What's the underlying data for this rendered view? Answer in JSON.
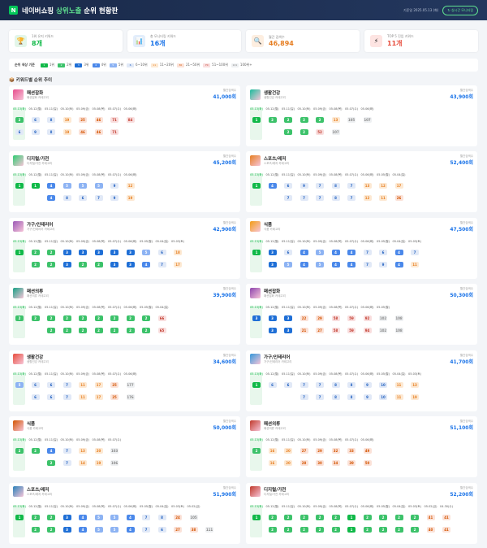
{
  "header": {
    "logo": "N",
    "title_a": "네이버쇼핑 ",
    "title_hl": "상위노출",
    "title_b": " 순위 현황판",
    "date": "기준일 2025.05.13 (화)",
    "btn": "↻ 실시간 모니터링"
  },
  "stats": [
    {
      "icon": "🏆",
      "label": "1위 유지 키워드",
      "value": "8개",
      "color": "#10b948",
      "bg": "#e3f6e9"
    },
    {
      "icon": "📊",
      "label": "총 모니터링 키워드",
      "value": "16개",
      "color": "#1a73e8",
      "bg": "#e3eefc"
    },
    {
      "icon": "🔍",
      "label": "월간 검색수",
      "value": "46,894",
      "color": "#e67e22",
      "bg": "#fdeee0"
    },
    {
      "icon": "⚡",
      "label": "TOP 5 진입 키워드",
      "value": "11개",
      "color": "#e74c3c",
      "bg": "#fde4e2"
    }
  ],
  "legend": {
    "title": "순위 색상 기준",
    "items": [
      {
        "label": "1위",
        "cls": "r1",
        "t": "1"
      },
      {
        "label": "2위",
        "cls": "r2",
        "t": "2"
      },
      {
        "label": "3위",
        "cls": "r3",
        "t": "3"
      },
      {
        "label": "4위",
        "cls": "r4",
        "t": "4"
      },
      {
        "label": "5위",
        "cls": "r5",
        "t": "5"
      },
      {
        "label": "6~10위",
        "cls": "r6",
        "t": "6"
      },
      {
        "label": "11~20위",
        "cls": "r10",
        "t": "11"
      },
      {
        "label": "21~50위",
        "cls": "r20",
        "t": "30"
      },
      {
        "label": "51~100위",
        "cls": "r50",
        "t": "70"
      },
      {
        "label": "100위+",
        "cls": "r100",
        "t": "101"
      }
    ]
  },
  "section_title": "📦 키워드별 순위 추이",
  "cards": [
    {
      "name": "패션잡화",
      "sub": "패션잡화 카테고리",
      "vlabel": "월간검색수",
      "volume": "41,000회",
      "color": "#e74c8c",
      "dates": [
        "05.13(화)",
        "05.12(월)",
        "05.11(일)",
        "05.10(토)",
        "05.09(금)",
        "05.08(목)",
        "05.07(수)",
        "05.06(화)"
      ],
      "row1": [
        "2",
        "6",
        "8",
        "19",
        "25",
        "46",
        "71",
        "84"
      ],
      "row2": [
        "6",
        "9",
        "8",
        "19",
        "46",
        "46",
        "71",
        ""
      ]
    },
    {
      "name": "생활건강",
      "sub": "생활건강 카테고리",
      "vlabel": "월간검색수",
      "volume": "43,900회",
      "color": "#1abc9c",
      "dates": [
        "05.13(화)",
        "05.12(월)",
        "05.11(일)",
        "05.10(토)",
        "05.09(금)",
        "05.08(목)",
        "05.07(수)",
        "05.06(화)"
      ],
      "row1": [
        "1",
        "2",
        "2",
        "2",
        "2",
        "13",
        "105",
        "107"
      ],
      "row2": [
        "",
        "",
        "2",
        "2",
        "52",
        "107",
        "",
        ""
      ]
    },
    {
      "name": "디지털/가전",
      "sub": "디지털/가전 카테고리",
      "vlabel": "월간검색수",
      "volume": "45,200회",
      "color": "#2ecc71",
      "dates": [
        "05.13(화)",
        "05.12(월)",
        "05.11(일)",
        "05.10(토)",
        "05.09(금)",
        "05.08(목)",
        "05.07(수)",
        "05.06(화)"
      ],
      "row1": [
        "1",
        "1",
        "4",
        "5",
        "5",
        "5",
        "9",
        "12"
      ],
      "row2": [
        "",
        "",
        "4",
        "8",
        "6",
        "7",
        "9",
        "19"
      ]
    },
    {
      "name": "스포츠/레저",
      "sub": "스포츠/레저 카테고리",
      "vlabel": "월간검색수",
      "volume": "52,400회",
      "color": "#e67e22",
      "dates": [
        "05.13(화)",
        "05.12(월)",
        "05.11(일)",
        "05.10(토)",
        "05.09(금)",
        "05.08(목)",
        "05.07(수)",
        "05.06(화)",
        "05.05(월)",
        "05.04(일)"
      ],
      "row1": [
        "1",
        "4",
        "6",
        "9",
        "7",
        "8",
        "7",
        "13",
        "12",
        "17"
      ],
      "row2": [
        "",
        "",
        "7",
        "7",
        "7",
        "8",
        "7",
        "12",
        "11",
        "26"
      ]
    },
    {
      "name": "가구/인테리어",
      "sub": "가구/인테리어 카테고리",
      "vlabel": "월간검색수",
      "volume": "42,900회",
      "color": "#9b59b6",
      "dates": [
        "05.13(화)",
        "05.12(월)",
        "05.11(일)",
        "05.10(토)",
        "05.09(금)",
        "05.08(목)",
        "05.07(수)",
        "05.06(화)",
        "05.05(월)",
        "05.04(일)",
        "05.03(토)"
      ],
      "row1": [
        "1",
        "2",
        "2",
        "3",
        "3",
        "3",
        "3",
        "3",
        "5",
        "6",
        "18"
      ],
      "row2": [
        "",
        "2",
        "2",
        "3",
        "2",
        "2",
        "3",
        "3",
        "4",
        "7",
        "17"
      ]
    },
    {
      "name": "식품",
      "sub": "식품 카테고리",
      "vlabel": "월간검색수",
      "volume": "47,500회",
      "color": "#f39c12",
      "dates": [
        "05.13(화)",
        "05.12(월)",
        "05.11(일)",
        "05.10(토)",
        "05.09(금)",
        "05.08(목)",
        "05.07(수)",
        "05.06(화)",
        "05.05(월)",
        "05.04(일)",
        "05.03(토)"
      ],
      "row1": [
        "1",
        "3",
        "6",
        "4",
        "5",
        "4",
        "4",
        "7",
        "6",
        "4",
        "7"
      ],
      "row2": [
        "",
        "3",
        "5",
        "4",
        "5",
        "4",
        "4",
        "7",
        "9",
        "4",
        "11"
      ]
    },
    {
      "name": "패션의류",
      "sub": "패션의류 카테고리",
      "vlabel": "월간검색수",
      "volume": "39,900회",
      "color": "#16a085",
      "dates": [
        "05.13(화)",
        "05.12(월)",
        "05.11(일)",
        "05.10(토)",
        "05.09(금)",
        "05.08(목)",
        "05.07(수)",
        "05.06(화)",
        "05.05(월)",
        "05.04(일)"
      ],
      "row1": [
        "2",
        "2",
        "2",
        "2",
        "2",
        "2",
        "2",
        "2",
        "2",
        "66"
      ],
      "row2": [
        "",
        "",
        "2",
        "2",
        "2",
        "2",
        "2",
        "2",
        "2",
        "65"
      ]
    },
    {
      "name": "패션잡화",
      "sub": "패션잡화 카테고리",
      "vlabel": "월간검색수",
      "volume": "50,300회",
      "color": "#8e44ad",
      "dates": [
        "05.13(화)",
        "05.12(월)",
        "05.11(일)",
        "05.10(토)",
        "05.09(금)",
        "05.08(목)",
        "05.07(수)",
        "05.06(화)",
        "05.05(월)"
      ],
      "row1": [
        "3",
        "3",
        "3",
        "22",
        "29",
        "58",
        "59",
        "92",
        "102",
        "108"
      ],
      "row2": [
        "",
        "3",
        "3",
        "21",
        "27",
        "58",
        "59",
        "94",
        "102",
        "108"
      ]
    },
    {
      "name": "생활건강",
      "sub": "생활건강 카테고리",
      "vlabel": "월간검색수",
      "volume": "34,600회",
      "color": "#e74c3c",
      "dates": [
        "05.13(화)",
        "05.12(월)",
        "05.11(일)",
        "05.10(토)",
        "05.09(금)",
        "05.08(목)",
        "05.07(수)",
        "05.06(화)"
      ],
      "row1": [
        "5",
        "6",
        "6",
        "7",
        "11",
        "17",
        "25",
        "177"
      ],
      "row2": [
        "",
        "6",
        "6",
        "7",
        "11",
        "17",
        "25",
        "176"
      ]
    },
    {
      "name": "가구/인테리어",
      "sub": "가구/인테리어 카테고리",
      "vlabel": "월간검색수",
      "volume": "41,700회",
      "color": "#3498db",
      "dates": [
        "05.13(화)",
        "05.12(월)",
        "05.11(일)",
        "05.10(토)",
        "05.09(금)",
        "05.08(목)",
        "05.07(수)",
        "05.06(화)",
        "05.05(월)",
        "05.04(일)",
        "05.03(토)"
      ],
      "row1": [
        "1",
        "6",
        "6",
        "7",
        "7",
        "8",
        "8",
        "9",
        "10",
        "11",
        "13"
      ],
      "row2": [
        "",
        "",
        "",
        "7",
        "7",
        "8",
        "8",
        "9",
        "10",
        "11",
        "19"
      ]
    },
    {
      "name": "식품",
      "sub": "식품 카테고리",
      "vlabel": "월간검색수",
      "volume": "50,000회",
      "color": "#d35400",
      "dates": [
        "05.13(화)",
        "05.12(월)",
        "05.11(일)",
        "05.10(토)",
        "05.09(금)",
        "05.08(목)",
        "05.07(수)"
      ],
      "row1": [
        "2",
        "2",
        "4",
        "7",
        "13",
        "20",
        "103"
      ],
      "row2": [
        "",
        "",
        "2",
        "7",
        "14",
        "19",
        "106"
      ]
    },
    {
      "name": "패션의류",
      "sub": "패션의류 카테고리",
      "vlabel": "월간검색수",
      "volume": "51,100회",
      "color": "#c0392b",
      "dates": [
        "05.13(화)",
        "05.12(월)",
        "05.11(일)",
        "05.10(토)",
        "05.09(금)",
        "05.08(목)",
        "05.07(수)",
        "05.06(화)"
      ],
      "row1": [
        "2",
        "16",
        "20",
        "27",
        "29",
        "32",
        "33",
        "49"
      ],
      "row2": [
        "",
        "16",
        "20",
        "28",
        "30",
        "34",
        "39",
        "50"
      ]
    },
    {
      "name": "스포츠/레저",
      "sub": "스포츠/레저 카테고리",
      "vlabel": "월간검색수",
      "volume": "51,900회",
      "color": "#2980b9",
      "dates": [
        "05.13(화)",
        "05.12(월)",
        "05.11(일)",
        "05.10(토)",
        "05.09(금)",
        "05.08(목)",
        "05.07(수)",
        "05.06(화)",
        "05.05(월)",
        "05.04(일)",
        "05.03(토)",
        "05.02(금)"
      ],
      "row1": [
        "1",
        "2",
        "2",
        "3",
        "4",
        "5",
        "5",
        "4",
        "7",
        "8",
        "24",
        "105"
      ],
      "row2": [
        "",
        "2",
        "2",
        "3",
        "4",
        "5",
        "5",
        "4",
        "7",
        "6",
        "27",
        "38",
        "111"
      ]
    },
    {
      "name": "디지털/가전",
      "sub": "디지털/가전 카테고리",
      "vlabel": "월간검색수",
      "volume": "52,200회",
      "color": "#c0392b",
      "dates": [
        "05.13(화)",
        "05.12(월)",
        "05.11(일)",
        "05.10(토)",
        "05.09(금)",
        "05.08(목)",
        "05.07(수)",
        "05.06(화)",
        "05.05(월)",
        "05.04(일)",
        "05.03(토)",
        "05.02(금)",
        "04.30(수)"
      ],
      "row1": [
        "1",
        "2",
        "2",
        "2",
        "2",
        "2",
        "1",
        "2",
        "2",
        "2",
        "2",
        "41",
        "41"
      ],
      "row2": [
        "",
        "2",
        "2",
        "2",
        "2",
        "2",
        "1",
        "2",
        "2",
        "2",
        "2",
        "40",
        "41"
      ]
    }
  ]
}
